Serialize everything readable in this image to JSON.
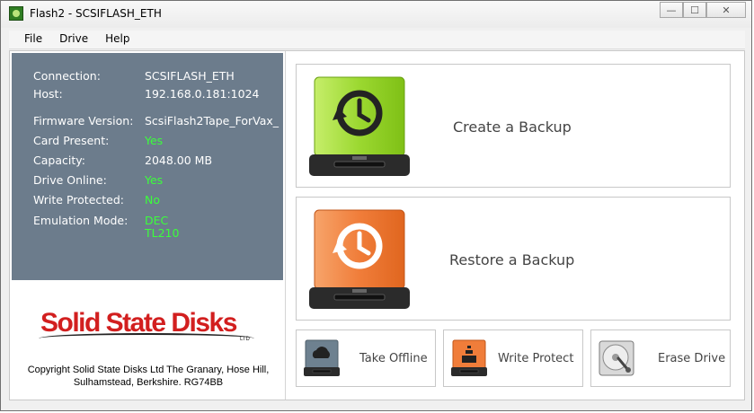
{
  "window": {
    "title": "Flash2 - SCSIFLASH_ETH",
    "minimize_glyph": "—",
    "maximize_glyph": "☐",
    "close_glyph": "✕"
  },
  "menu": [
    "File",
    "Drive",
    "Help"
  ],
  "info": {
    "connection_label": "Connection:",
    "connection_value": "SCSIFLASH_ETH",
    "host_label": "Host:",
    "host_value": "192.168.0.181:1024",
    "firmware_label": "Firmware Version:",
    "firmware_value": "ScsiFlash2Tape_ForVax_",
    "card_label": "Card Present:",
    "card_value": "Yes",
    "capacity_label": "Capacity:",
    "capacity_value": "2048.00 MB",
    "online_label": "Drive Online:",
    "online_value": "Yes",
    "protected_label": "Write Protected:",
    "protected_value": "No",
    "emulation_label": "Emulation Mode:",
    "emulation_line1": "DEC",
    "emulation_line2": "TL210"
  },
  "branding": {
    "logo_text": "Solid State Disks",
    "logo_ltd": "LTD",
    "copyright_line1": "Copyright Solid State Disks Ltd The Granary, Hose Hill,",
    "copyright_line2": "Sulhamstead, Berkshire. RG74BB"
  },
  "actions": {
    "create_backup": "Create a Backup",
    "restore_backup": "Restore a Backup",
    "take_offline": "Take Offline",
    "write_protect": "Write Protect",
    "erase_drive": "Erase Drive"
  },
  "colors": {
    "info_panel_bg": "#6c7c8c",
    "status_green": "#3bff3b",
    "create_drive": "#8fd12a",
    "restore_drive": "#ef7a33",
    "logo_red": "#d21f1f"
  }
}
